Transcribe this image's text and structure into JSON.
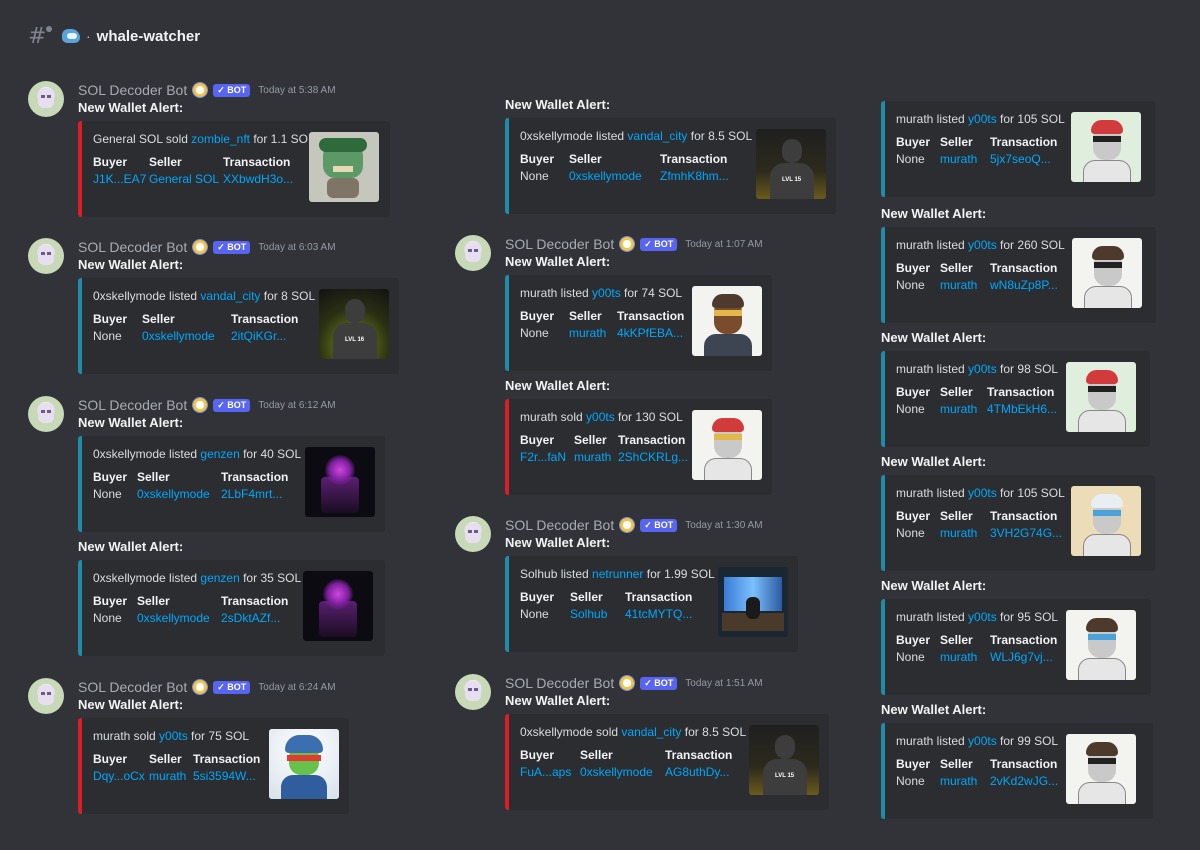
{
  "channel": {
    "name": "whale-watcher"
  },
  "author": {
    "name": "SOL Decoder Bot",
    "bot_tag": "BOT"
  },
  "field_labels": {
    "buyer": "Buyer",
    "seller": "Seller",
    "transaction": "Transaction"
  },
  "alert_title": "New Wallet Alert:",
  "messages": [
    {
      "time": "Today at 5:38 AM",
      "desc_pre": "General SOL sold ",
      "item": "zombie_nft",
      "desc_post": " for 1.1 SOL",
      "buyer": "J1K...EA7",
      "seller": "General SOL",
      "transaction": "XXbwdH3o...",
      "thumbnail": "zombie-nft-icon",
      "color": "#da1d26"
    },
    {
      "time": "Today at 6:03 AM",
      "desc_pre": "0xskellymode listed ",
      "item": "vandal_city",
      "desc_post": " for 8 SOL",
      "buyer": "None",
      "seller": "0xskellymode",
      "transaction": "2itQiKGr...",
      "thumbnail": "vandal-city-icon",
      "thumbnail_text": "LVL 16",
      "color": "#1f8da8"
    },
    {
      "time": "Today at 6:12 AM",
      "desc_pre": "0xskellymode listed ",
      "item": "genzen",
      "desc_post": " for 40 SOL",
      "buyer": "None",
      "seller": "0xskellymode",
      "transaction": "2LbF4mrt...",
      "thumbnail": "genzen-icon",
      "color": "#1f8da8"
    },
    {
      "desc_pre": "0xskellymode listed ",
      "item": "genzen",
      "desc_post": " for 35 SOL",
      "buyer": "None",
      "seller": "0xskellymode",
      "transaction": "2sDktAZf...",
      "thumbnail": "genzen-icon",
      "color": "#1f8da8"
    },
    {
      "time": "Today at 6:24 AM",
      "desc_pre": "murath sold ",
      "item": "y00ts",
      "desc_post": " for 75 SOL",
      "buyer": "Dqy...oCx",
      "seller": "murath",
      "transaction": "5si3594W...",
      "thumbnail": "y00t-icon",
      "color": "#da1d26"
    },
    {
      "desc_pre": "0xskellymode listed ",
      "item": "vandal_city",
      "desc_post": " for 8.5 SOL",
      "buyer": "None",
      "seller": "0xskellymode",
      "transaction": "ZfmhK8hm...",
      "thumbnail": "vandal-city-icon",
      "thumbnail_text": "LVL 15",
      "color": "#1f8da8"
    },
    {
      "time": "Today at 1:07 AM",
      "desc_pre": "murath listed ",
      "item": "y00ts",
      "desc_post": " for 74 SOL",
      "buyer": "None",
      "seller": "murath",
      "transaction": "4kKPfEBA...",
      "thumbnail": "y00t-icon",
      "color": "#1f8da8"
    },
    {
      "desc_pre": "murath sold ",
      "item": "y00ts",
      "desc_post": " for 130 SOL",
      "buyer": "F2r...faN",
      "seller": "murath",
      "transaction": "2ShCKRLg...",
      "thumbnail": "y00t-icon",
      "color": "#da1d26"
    },
    {
      "time": "Today at 1:30 AM",
      "desc_pre": "Solhub listed ",
      "item": "netrunner",
      "desc_post": " for 1.99 SOL",
      "buyer": "None",
      "seller": "Solhub",
      "transaction": "41tcMYTQ...",
      "thumbnail": "netrunner-icon",
      "color": "#1f8da8"
    },
    {
      "time": "Today at 1:51 AM",
      "desc_pre": "0xskellymode sold ",
      "item": "vandal_city",
      "desc_post": " for 8.5 SOL",
      "buyer": "FuA...aps",
      "seller": "0xskellymode",
      "transaction": "AG8uthDy...",
      "thumbnail": "vandal-city-icon",
      "thumbnail_text": "LVL 15",
      "color": "#da1d26"
    },
    {
      "desc_pre": "murath listed ",
      "item": "y00ts",
      "desc_post": " for 105 SOL",
      "buyer": "None",
      "seller": "murath",
      "transaction": "5jx7seoQ...",
      "thumbnail": "y00t-icon",
      "color": "#1f8da8"
    },
    {
      "desc_pre": "murath listed ",
      "item": "y00ts",
      "desc_post": " for 260 SOL",
      "buyer": "None",
      "seller": "murath",
      "transaction": "wN8uZp8P...",
      "thumbnail": "y00t-icon",
      "color": "#1f8da8"
    },
    {
      "desc_pre": "murath listed ",
      "item": "y00ts",
      "desc_post": " for 98 SOL",
      "buyer": "None",
      "seller": "murath",
      "transaction": "4TMbEkH6...",
      "thumbnail": "y00t-icon",
      "color": "#1f8da8"
    },
    {
      "desc_pre": "murath listed ",
      "item": "y00ts",
      "desc_post": " for 105 SOL",
      "buyer": "None",
      "seller": "murath",
      "transaction": "3VH2G74G...",
      "thumbnail": "y00t-icon",
      "color": "#1f8da8"
    },
    {
      "desc_pre": "murath listed ",
      "item": "y00ts",
      "desc_post": " for 95 SOL",
      "buyer": "None",
      "seller": "murath",
      "transaction": "WLJ6g7vj...",
      "thumbnail": "y00t-icon",
      "color": "#1f8da8"
    },
    {
      "desc_pre": "murath listed ",
      "item": "y00ts",
      "desc_post": " for 99 SOL",
      "buyer": "None",
      "seller": "murath",
      "transaction": "2vKd2wJG...",
      "thumbnail": "y00t-icon",
      "color": "#1f8da8"
    }
  ]
}
